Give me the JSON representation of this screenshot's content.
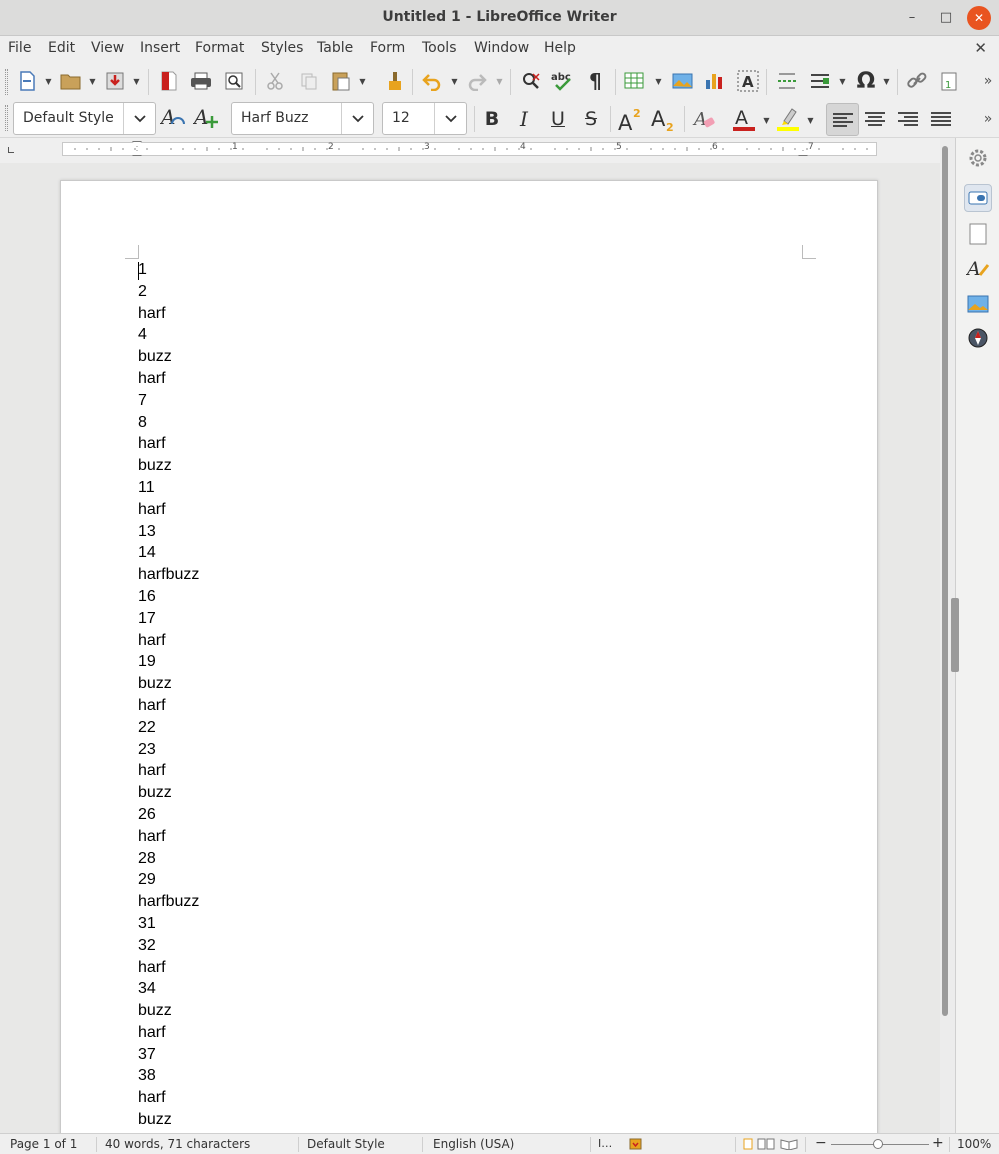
{
  "window": {
    "title": "Untitled 1 - LibreOffice Writer"
  },
  "menu": [
    "File",
    "Edit",
    "View",
    "Insert",
    "Format",
    "Styles",
    "Table",
    "Form",
    "Tools",
    "Window",
    "Help"
  ],
  "formatting": {
    "paragraph_style": "Default Style",
    "font_name": "Harf Buzz",
    "font_size": "12"
  },
  "document": {
    "lines": [
      "1",
      "2",
      "harf",
      "4",
      "buzz",
      "harf",
      "7",
      "8",
      "harf",
      "buzz",
      "11",
      "harf",
      "13",
      "14",
      "harfbuzz",
      "16",
      "17",
      "harf",
      "19",
      "buzz",
      "harf",
      "22",
      "23",
      "harf",
      "buzz",
      "26",
      "harf",
      "28",
      "29",
      "harfbuzz",
      "31",
      "32",
      "harf",
      "34",
      "buzz",
      "harf",
      "37",
      "38",
      "harf",
      "buzz"
    ]
  },
  "ruler": {
    "numbers": [
      "1",
      "2",
      "3",
      "4",
      "5",
      "6",
      "7"
    ]
  },
  "status": {
    "page": "Page 1 of 1",
    "words": "40 words, 71 characters",
    "style": "Default Style",
    "language": "English (USA)",
    "zoom": "100%"
  },
  "colors": {
    "font_color": "#c9211e",
    "highlight_color": "#ffff00",
    "accent": "#e95420"
  },
  "icons": {
    "toolbar1": [
      "new-document-icon",
      "open-icon",
      "save-icon",
      "export-pdf-icon",
      "print-icon",
      "print-preview-icon",
      "cut-icon",
      "copy-icon",
      "paste-icon",
      "clone-formatting-icon",
      "undo-icon",
      "redo-icon",
      "find-replace-icon",
      "spelling-icon",
      "formatting-marks-icon",
      "insert-table-icon",
      "insert-image-icon",
      "insert-chart-icon",
      "insert-textbox-icon",
      "page-break-icon",
      "insert-field-icon",
      "special-character-icon",
      "hyperlink-icon",
      "footnote-icon"
    ],
    "toolbar2": [
      "update-style-icon",
      "new-style-icon",
      "bold-icon",
      "italic-icon",
      "underline-icon",
      "strikethrough-icon",
      "superscript-icon",
      "subscript-icon",
      "clear-formatting-icon",
      "font-color-icon",
      "highlighting-icon",
      "align-left-icon",
      "align-center-icon",
      "align-right-icon",
      "justify-icon"
    ],
    "sidebar": [
      "properties-icon",
      "page-icon",
      "styles-icon",
      "gallery-icon",
      "navigator-icon"
    ]
  }
}
